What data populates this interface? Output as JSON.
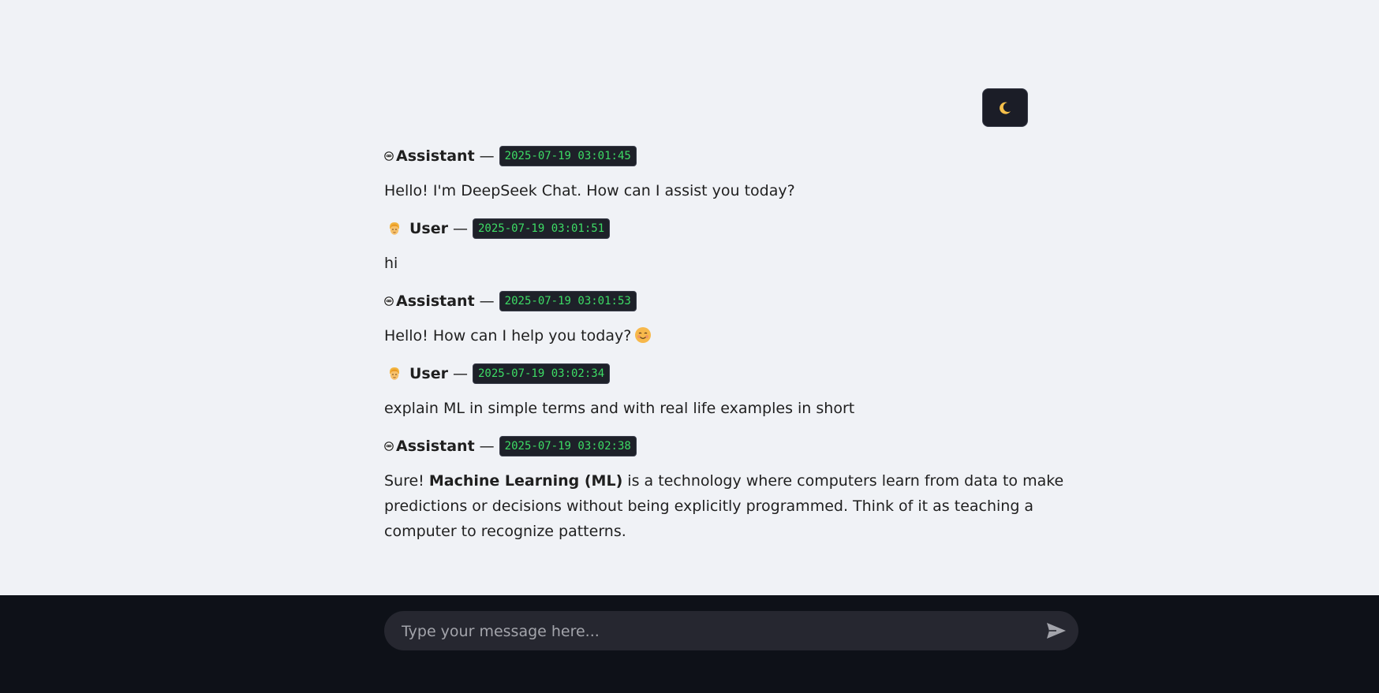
{
  "theme_toggle": {
    "icon": "moon-icon"
  },
  "messages": [
    {
      "role": "assistant",
      "name": "Assistant",
      "separator": "—",
      "timestamp": "2025-07-19 03:01:45",
      "text": "Hello! I'm DeepSeek Chat. How can I assist you today?"
    },
    {
      "role": "user",
      "name": "User",
      "separator": "—",
      "timestamp": "2025-07-19 03:01:51",
      "text": "hi"
    },
    {
      "role": "assistant",
      "name": "Assistant",
      "separator": "—",
      "timestamp": "2025-07-19 03:01:53",
      "text": "Hello! How can I help you today?",
      "trailing_icon": "smiling-face-icon"
    },
    {
      "role": "user",
      "name": "User",
      "separator": "—",
      "timestamp": "2025-07-19 03:02:34",
      "text": "explain ML in simple terms and with real life examples in short"
    },
    {
      "role": "assistant",
      "name": "Assistant",
      "separator": "—",
      "timestamp": "2025-07-19 03:02:38",
      "text_prefix": "Sure! ",
      "text_bold": "Machine Learning (ML)",
      "text_suffix": " is a technology where computers learn from data to make predictions or decisions without being explicitly programmed. Think of it as teaching a computer to recognize patterns."
    }
  ],
  "input": {
    "placeholder": "Type your message here...",
    "value": ""
  },
  "send_button": {
    "icon": "send-icon"
  },
  "colors": {
    "page_bg": "#f0f2f6",
    "bottom_bar_bg": "#0e1118",
    "input_bg": "#262730",
    "timestamp_bg": "#1e2129",
    "timestamp_text": "#3ddc65"
  }
}
